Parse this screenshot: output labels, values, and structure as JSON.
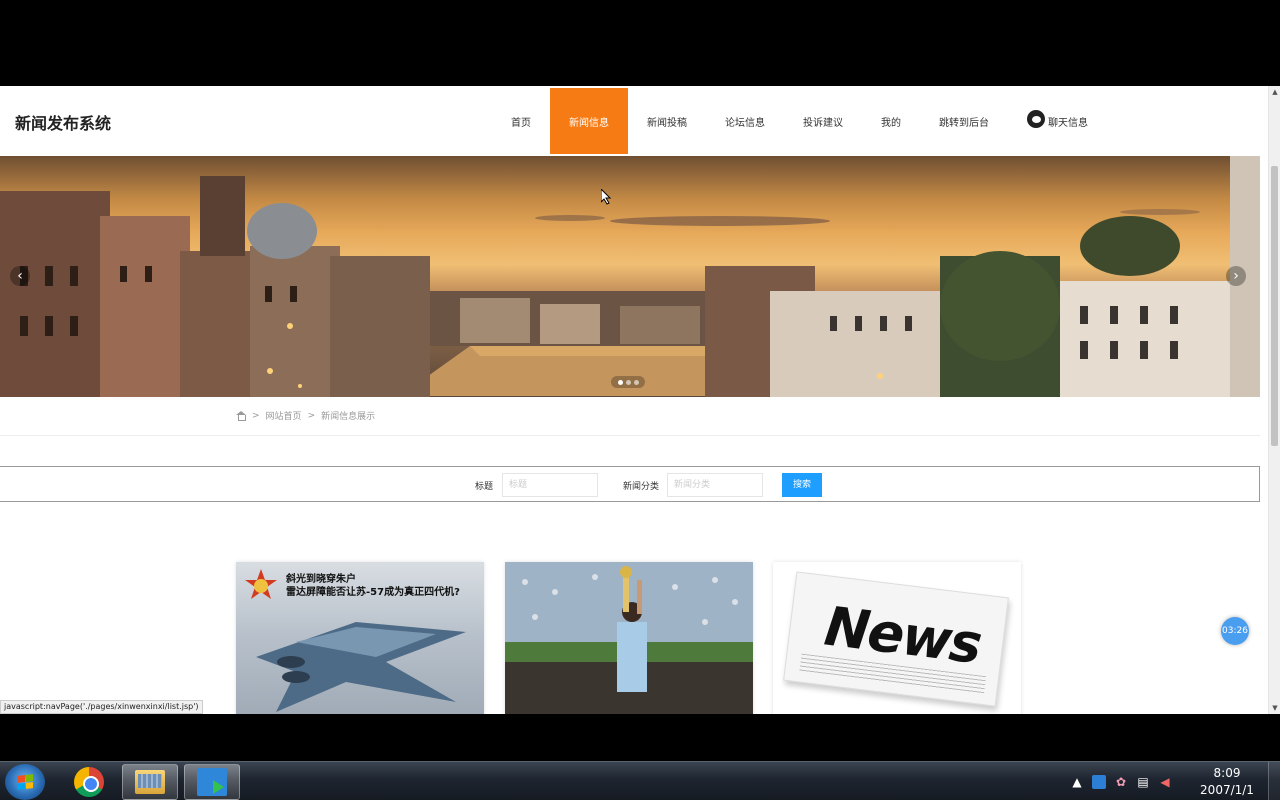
{
  "site": {
    "title": "新闻发布系统"
  },
  "nav": {
    "items": [
      {
        "label": "首页"
      },
      {
        "label": "新闻信息",
        "active": true
      },
      {
        "label": "新闻投稿"
      },
      {
        "label": "论坛信息"
      },
      {
        "label": "投诉建议"
      },
      {
        "label": "我的"
      },
      {
        "label": "跳转到后台"
      },
      {
        "label": "聊天信息",
        "icon": "wechat-icon"
      }
    ]
  },
  "banner": {
    "prev": "‹",
    "next": "›",
    "slides": 3,
    "active_slide": 1
  },
  "breadcrumb": {
    "sep": ">",
    "home": "网站首页",
    "current": "新闻信息展示"
  },
  "search": {
    "title_label": "标题",
    "title_placeholder": "标题",
    "category_label": "新闻分类",
    "category_placeholder": "新闻分类",
    "button": "搜索",
    "button_color": "#1e9fff"
  },
  "cards": [
    {
      "headline_1": "斜光到晓穿朱户",
      "headline_2": "雷达屏障能否让苏-57成为真正四代机?"
    },
    {},
    {
      "image_text": "News"
    }
  ],
  "timer": "03:26",
  "status_url": "javascript:navPage('./pages/xinwenxinxi/list.jsp')",
  "taskbar": {
    "clock_time": "8:09",
    "clock_date": "2007/1/1"
  },
  "colors": {
    "nav_active": "#f77b14",
    "accent": "#1e9fff"
  }
}
